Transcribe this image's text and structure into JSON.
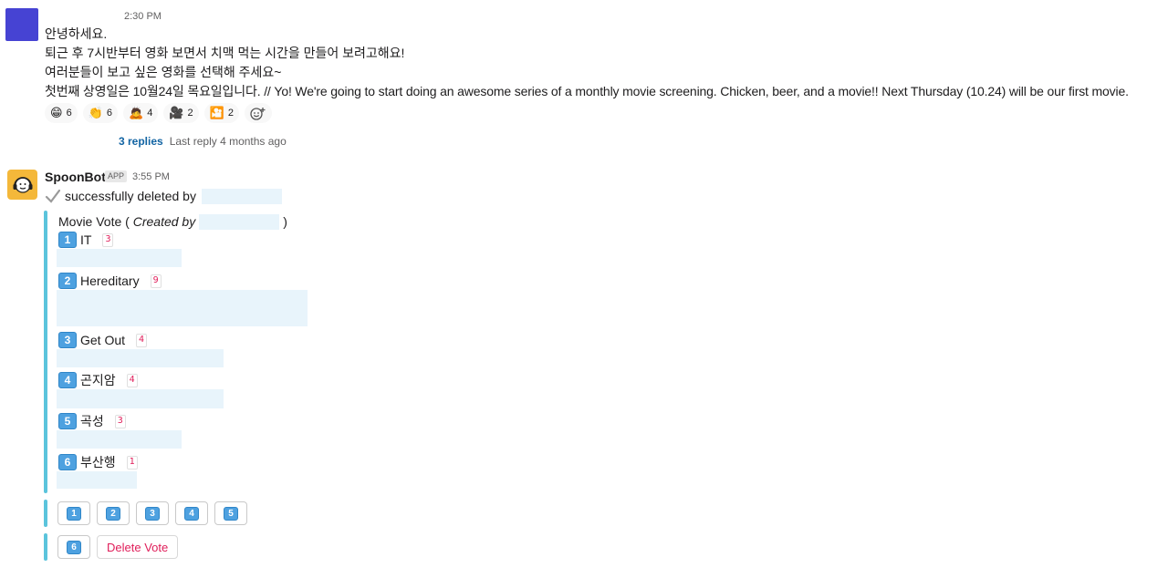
{
  "message1": {
    "timestamp": "2:30 PM",
    "lines": [
      "안녕하세요.",
      "퇴근 후 7시반부터 영화 보면서 치맥 먹는 시간을 만들어 보려고해요!",
      "여러분들이 보고 싶은 영화를 선택해 주세요~",
      "첫번째 상영일은 10월24일 목요일입니다. // Yo! We're going to start doing an awesome series of a monthly movie screening. Chicken, beer, and a movie!! Next Thursday (10.24) will be our first movie."
    ],
    "reactions": [
      {
        "emoji": "😁",
        "icon": "grinning-face-icon",
        "count": "6"
      },
      {
        "emoji": "👏",
        "icon": "clapping-hands-icon",
        "count": "6"
      },
      {
        "emoji": "🙇",
        "icon": "bowing-person-icon",
        "count": "4"
      },
      {
        "emoji": "🎥",
        "icon": "movie-camera-icon",
        "count": "2"
      },
      {
        "emoji": "🎦",
        "icon": "cinema-icon",
        "count": "2"
      }
    ],
    "thread": {
      "replies": "3 replies",
      "last_reply": "Last reply 4 months ago"
    }
  },
  "message2": {
    "sender": "SpoonBot",
    "badge": "APP",
    "timestamp": "3:55 PM",
    "deleted_text": "successfully deleted by",
    "vote": {
      "title": "Movie Vote",
      "created_by": "Created by",
      "options": [
        {
          "key": "1",
          "label": "IT",
          "count": "3",
          "votes": 3
        },
        {
          "key": "2",
          "label": "Hereditary",
          "count": "9",
          "votes": 9
        },
        {
          "key": "3",
          "label": "Get Out",
          "count": "4",
          "votes": 4
        },
        {
          "key": "4",
          "label": "곤지암",
          "count": "4",
          "votes": 4
        },
        {
          "key": "5",
          "label": "곡성",
          "count": "3",
          "votes": 3
        },
        {
          "key": "6",
          "label": "부산행",
          "count": "1",
          "votes": 1
        }
      ]
    },
    "buttons": {
      "row1": [
        "1",
        "2",
        "3",
        "4",
        "5"
      ],
      "row2": [
        "6"
      ],
      "delete_label": "Delete Vote"
    }
  },
  "colors": {
    "accent_bar": "#5bc4dc",
    "link": "#1264a3",
    "danger": "#e01e5a",
    "redacted": "#e8f4fb",
    "keycap": "#4ea1e0"
  }
}
